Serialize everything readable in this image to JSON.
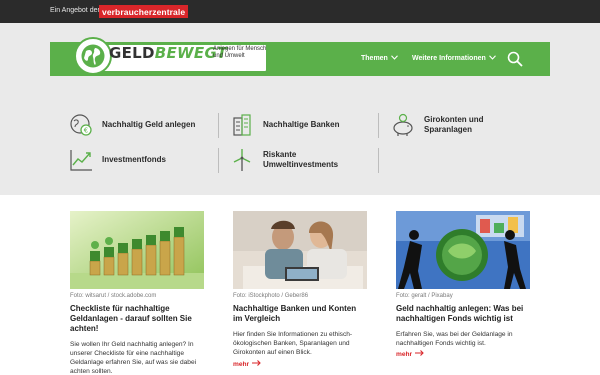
{
  "topbar": {
    "offer": "Ein Angebot der:",
    "brand": "verbraucherzentrale"
  },
  "header": {
    "logo_main": "GELD",
    "logo_accent": "BEWEGT",
    "logo_sub": "Anlegen für Mensch und Umwelt",
    "nav": [
      "Themen",
      "Weitere Informationen"
    ]
  },
  "categories": [
    {
      "label": "Nachhaltig Geld anlegen",
      "icon": "globe-coin-icon"
    },
    {
      "label": "Nachhaltige Banken",
      "icon": "bank-building-icon"
    },
    {
      "label": "Girokonten und Sparanlagen",
      "icon": "piggy-bank-icon"
    },
    {
      "label": "Investmentfonds",
      "icon": "chart-line-icon"
    },
    {
      "label": "Riskante Umweltinvestments",
      "icon": "wind-turbine-icon"
    }
  ],
  "cards": [
    {
      "credit": "Foto: witsarut / stock.adobe.com",
      "title": "Checkliste für nachhaltige Geldanlagen - darauf sollten Sie achten!",
      "desc": "Sie wollen Ihr Geld nachhaltig anlegen? In unserer Checkliste für eine nachhaltige Geldanlage erfahren Sie, auf was sie dabei achten sollten.",
      "more": ""
    },
    {
      "credit": "Foto: iStockphoto / Geber86",
      "title": "Nachhaltige Banken und Konten im Vergleich",
      "desc": "Hier finden Sie Informationen zu ethisch-ökologischen Banken, Sparanlagen und Girokonten auf einen Blick.",
      "more": "mehr"
    },
    {
      "credit": "Foto: geralt / Pixabay",
      "title": "Geld nachhaltig anlegen: Was bei nachhaltigen Fonds wichtig ist",
      "desc": "Erfahren Sie, was bei der Geldanlage in nachhaltigen Fonds wichtig ist.",
      "more": "mehr"
    }
  ],
  "colors": {
    "brand_red": "#d9262a",
    "brand_green": "#5bb04a",
    "topbar": "#2b2b2b",
    "band_gray": "#eaeaea"
  }
}
